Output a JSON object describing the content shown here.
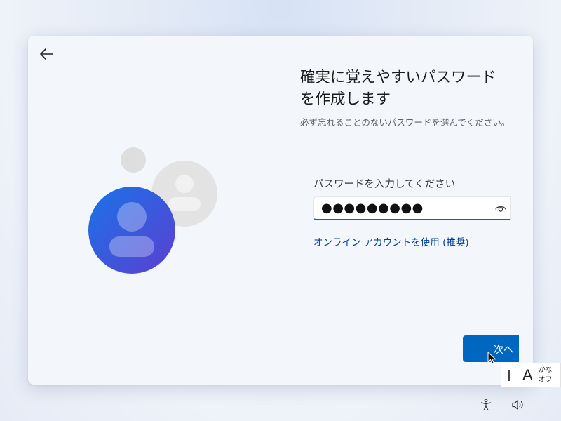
{
  "window": {
    "back_icon": "arrow-left-icon"
  },
  "illustration": {
    "icon": "user-accounts-illustration",
    "colors": {
      "primary_top": "#1a73e8",
      "primary_bottom": "#5b3fd1",
      "secondary": "#dcdcdc"
    }
  },
  "main": {
    "title": "確実に覚えやすいパスワードを作成します",
    "subtitle": "必ず忘れることのないパスワードを選んでください。",
    "field_label": "パスワードを入力してください",
    "password_value": "●●●●●●●●●",
    "reveal_icon": "eye-icon",
    "online_account_link": "オンライン アカウントを使用 (推奨)"
  },
  "footer": {
    "next_label": "次へ"
  },
  "ime": {
    "mode": "A",
    "state_line1": "かな",
    "state_line2": "オフ"
  },
  "tray": {
    "accessibility_icon": "accessibility-icon",
    "volume_icon": "volume-icon"
  },
  "colors": {
    "accent": "#0067c0",
    "link": "#003e92"
  }
}
